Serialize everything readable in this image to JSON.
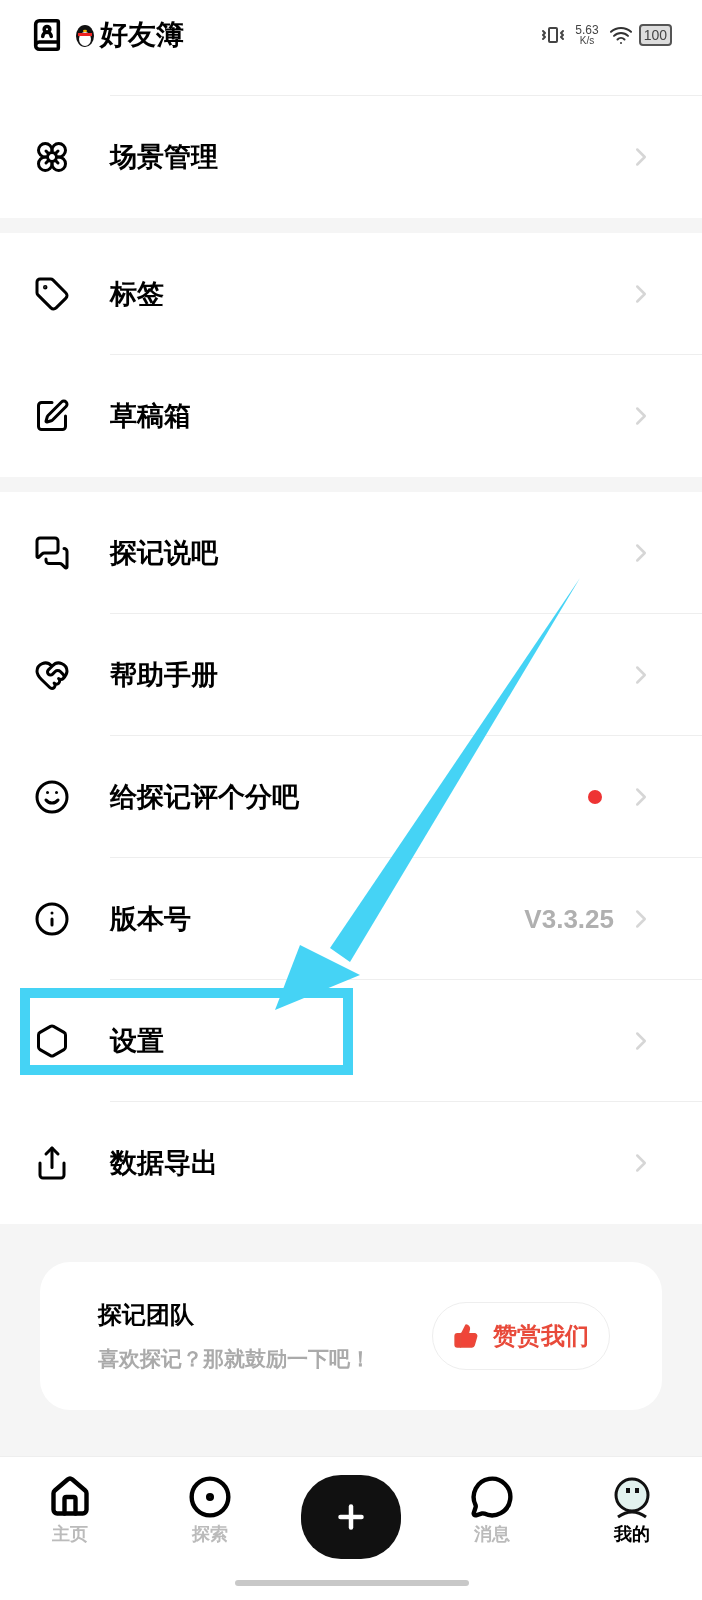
{
  "status_bar": {
    "notification": "好友簿",
    "speed": "5.63",
    "speed_unit": "K/s",
    "battery": "100"
  },
  "sections": [
    {
      "items": [
        {
          "label": "场景管理",
          "badge": false
        }
      ]
    },
    {
      "items": [
        {
          "label": "标签",
          "badge": false
        },
        {
          "label": "草稿箱",
          "badge": false
        }
      ]
    },
    {
      "items": [
        {
          "label": "探记说吧",
          "badge": false
        },
        {
          "label": "帮助手册",
          "badge": false
        },
        {
          "label": "给探记评个分吧",
          "badge": true
        },
        {
          "label": "版本号",
          "badge": false,
          "value": "V3.3.25"
        },
        {
          "label": "设置",
          "badge": false
        },
        {
          "label": "数据导出",
          "badge": false
        }
      ]
    }
  ],
  "team_card": {
    "title": "探记团队",
    "subtitle": "喜欢探记？那就鼓励一下吧！",
    "button": "赞赏我们"
  },
  "nav": [
    {
      "label": "主页",
      "selected": false
    },
    {
      "label": "探索",
      "selected": false
    },
    {
      "label": "消息",
      "selected": false
    },
    {
      "label": "我的",
      "selected": true
    }
  ]
}
